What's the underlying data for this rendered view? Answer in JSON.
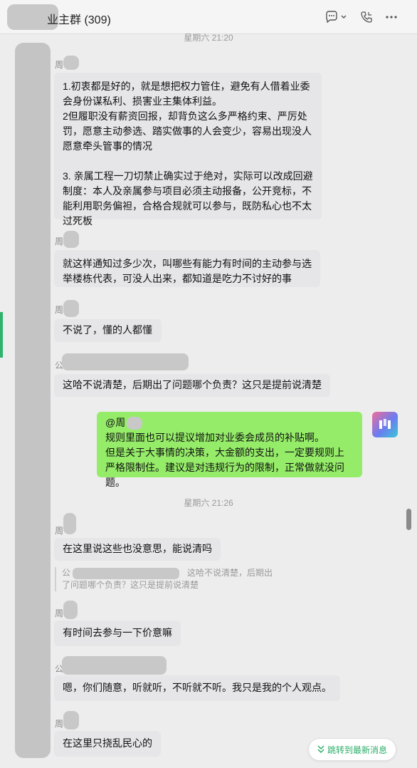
{
  "header": {
    "title": "业主群 (309)",
    "icons": [
      "chat-bubble-icon",
      "chevron-down-icon",
      "phone-icon",
      "more-icon"
    ]
  },
  "timestamps": [
    "星期六 21:20",
    "星期六 21:26"
  ],
  "messages": [
    {
      "sender": "周",
      "text": "1.初衷都是好的，就是想把权力管住，避免有人借着业委会身份谋私利、损害业主集体利益。\n2但履职没有薪资回报，却背负这么多严格约束、严厉处罚，愿意主动参选、踏实做事的人会变少，容易出现没人愿意牵头管事的情况\n\n3. 亲属工程一刀切禁止确实过于绝对，实际可以改成回避制度：本人及亲属参与项目必须主动报备，公开竞标，不能利用职务偏袒，合格合规就可以参与，既防私心也不太过死板"
    },
    {
      "sender": "周",
      "text": "就这样通知过多少次，叫哪些有能力有时间的主动参与选举楼栋代表，可没人出来，都知道是吃力不讨好的事"
    },
    {
      "sender": "周",
      "text": "不说了，懂的人都懂"
    },
    {
      "sender": "公",
      "text": "这哈不说清楚，后期出了问题哪个负责？这只是提前说清楚"
    },
    {
      "sender": "me",
      "mention": "@周",
      "text": "规则里面也可以提议增加对业委会成员的补贴啊。\n但是关于大事情的决策，大金额的支出，一定要规则上严格限制住。建议是对违规行为的限制，正常做就没问题。"
    },
    {
      "sender": "周",
      "text": "在这里说这些也没意思，能说清吗"
    },
    {
      "sender": "周",
      "text": "有时间去参与一下价意嘛",
      "quote": {
        "sender": "公",
        "text": "这哈不说清楚，后期出\n了问题哪个负责？这只是提前说清楚"
      }
    },
    {
      "sender": "公",
      "text": "嗯，你们随意，听就听，不听就不听。我只是我的个人观点。"
    },
    {
      "sender": "周",
      "text": "在这里只挠乱民心的"
    }
  ],
  "jump_button": {
    "label": "跳转到最新消息",
    "icon": "double-chevron-down-icon"
  },
  "colors": {
    "accent": "#2aae67",
    "my_bubble": "#95ec69",
    "other_bubble": "#e6e6e9",
    "background": "#ededed"
  }
}
